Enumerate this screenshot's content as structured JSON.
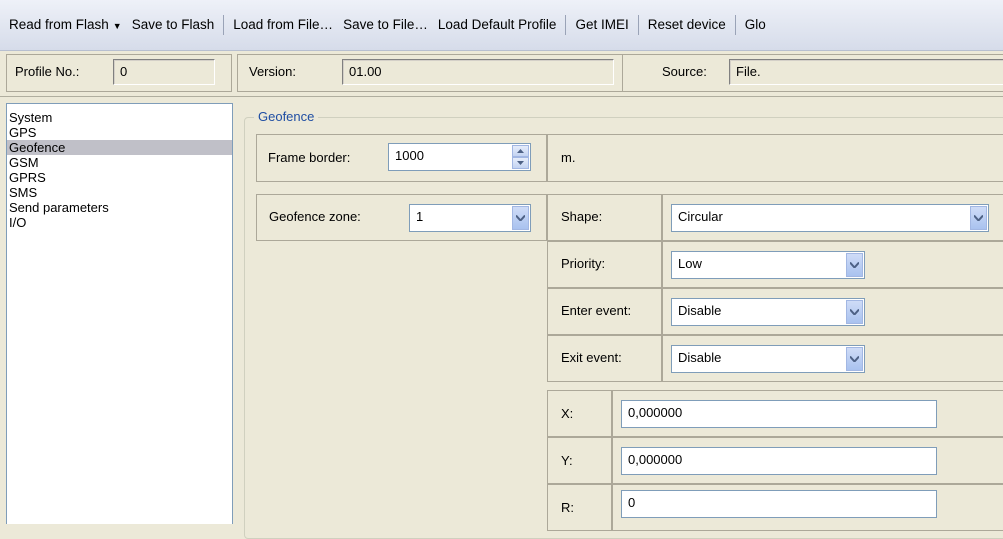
{
  "toolbar": {
    "read_flash": "Read from Flash",
    "save_flash": "Save to Flash",
    "load_file": "Load from File…",
    "save_file": "Save to File…",
    "load_default": "Load Default Profile",
    "get_imei": "Get IMEI",
    "reset_device": "Reset device",
    "global": "Glo"
  },
  "info": {
    "profile_label": "Profile No.:",
    "profile_value": "0",
    "version_label": "Version:",
    "version_value": "01.00",
    "source_label": "Source:",
    "source_value": "File."
  },
  "sidebar": {
    "items": [
      "System",
      "GPS",
      "Geofence",
      "GSM",
      "GPRS",
      "SMS",
      "Send parameters",
      "I/O"
    ],
    "selected": "Geofence"
  },
  "geofence": {
    "group_title": "Geofence",
    "frame_border_label": "Frame border:",
    "frame_border_value": "1000",
    "frame_border_unit": "m.",
    "zone_label": "Geofence zone:",
    "zone_value": "1",
    "shape_label": "Shape:",
    "shape_value": "Circular",
    "priority_label": "Priority:",
    "priority_value": "Low",
    "enter_label": "Enter event:",
    "enter_value": "Disable",
    "exit_label": "Exit event:",
    "exit_value": "Disable",
    "x_label": "X:",
    "x_value": "0,000000",
    "y_label": "Y:",
    "y_value": "0,000000",
    "r_label": "R:",
    "r_value": "0"
  }
}
